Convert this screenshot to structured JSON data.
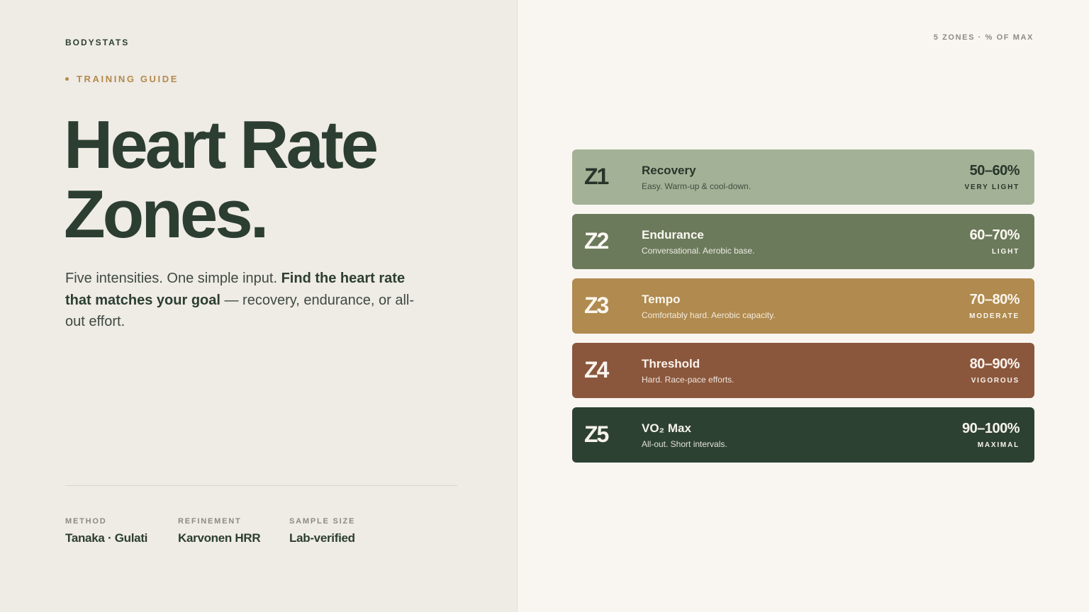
{
  "brand": "BODYSTATS",
  "eyebrow": "TRAINING GUIDE",
  "title": {
    "line1": "Heart Rate",
    "line2": "Zones."
  },
  "lead": {
    "part1": "Five intensities. One simple input. ",
    "bold": "Find the heart rate that matches your goal",
    "part2": " — recovery, endurance, or all-out effort."
  },
  "meta": [
    {
      "label": "METHOD",
      "value": "Tanaka · Gulati"
    },
    {
      "label": "REFINEMENT",
      "value": "Karvonen HRR"
    },
    {
      "label": "SAMPLE SIZE",
      "value": "Lab-verified"
    }
  ],
  "top_note": "5 ZONES · % OF MAX",
  "zones": [
    {
      "code": "Z1",
      "name": "Recovery",
      "desc": "Easy. Warm-up & cool-down.",
      "pct": "50–60%",
      "intensity": "VERY LIGHT",
      "color": "#a3b296"
    },
    {
      "code": "Z2",
      "name": "Endurance",
      "desc": "Conversational. Aerobic base.",
      "pct": "60–70%",
      "intensity": "LIGHT",
      "color": "#6b7a5b"
    },
    {
      "code": "Z3",
      "name": "Tempo",
      "desc": "Comfortably hard. Aerobic capacity.",
      "pct": "70–80%",
      "intensity": "MODERATE",
      "color": "#b08a4e"
    },
    {
      "code": "Z4",
      "name": "Threshold",
      "desc": "Hard. Race-pace efforts.",
      "pct": "80–90%",
      "intensity": "VIGOROUS",
      "color": "#8a573c"
    },
    {
      "code": "Z5",
      "name": "VO₂ Max",
      "desc": "All-out. Short intervals.",
      "pct": "90–100%",
      "intensity": "MAXIMAL",
      "color": "#2d4133"
    }
  ]
}
